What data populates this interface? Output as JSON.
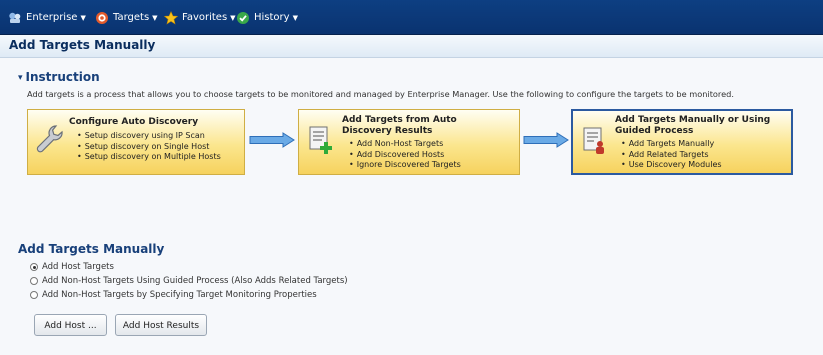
{
  "menubar": {
    "items": [
      {
        "label": "Enterprise",
        "icon": "enterprise-icon"
      },
      {
        "label": "Targets",
        "icon": "targets-icon"
      },
      {
        "label": "Favorites",
        "icon": "star-icon"
      },
      {
        "label": "History",
        "icon": "history-icon"
      }
    ]
  },
  "page": {
    "title": "Add Targets Manually"
  },
  "instruction": {
    "heading": "Instruction",
    "text": "Add targets is a process that allows you to choose targets to be monitored and managed by Enterprise Manager. Use the following to configure the targets to be monitored.",
    "steps": [
      {
        "title": "Configure Auto Discovery",
        "icon": "wrench-icon",
        "items": [
          "Setup discovery using IP Scan",
          "Setup discovery on Single Host",
          "Setup discovery on Multiple Hosts"
        ]
      },
      {
        "title_line1": "Add Targets from Auto",
        "title_line2": "Discovery Results",
        "icon": "document-add-icon",
        "items": [
          "Add Non-Host Targets",
          "Add Discovered Hosts",
          "Ignore Discovered Targets"
        ]
      },
      {
        "title_line1": "Add Targets Manually or Using",
        "title_line2": "Guided Process",
        "icon": "document-person-icon",
        "items": [
          "Add Targets Manually",
          "Add Related Targets",
          "Use Discovery Modules"
        ],
        "selected": true
      }
    ]
  },
  "add_manually": {
    "heading": "Add Targets Manually",
    "options": [
      {
        "label": "Add Host Targets",
        "selected": true
      },
      {
        "label": "Add Non-Host Targets Using Guided Process (Also Adds Related Targets)",
        "selected": false
      },
      {
        "label": "Add Non-Host Targets by Specifying Target Monitoring Properties",
        "selected": false
      }
    ],
    "buttons": {
      "add_host": "Add Host ...",
      "add_host_results": "Add Host Results"
    }
  },
  "colors": {
    "menubar": "#0d3f82",
    "heading": "#18407a",
    "card_fill": "#fbe68e",
    "selected_border": "#2b5aa0",
    "arrow": "#4a8fd8"
  }
}
